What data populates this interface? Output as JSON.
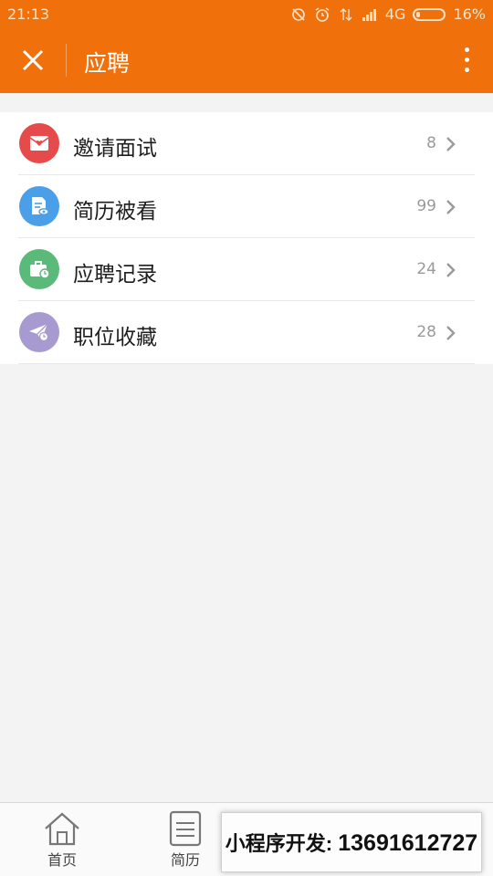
{
  "status_bar": {
    "time": "21:13",
    "network": "4G",
    "battery": "16%"
  },
  "header": {
    "title": "应聘",
    "background_color": "#f0700b"
  },
  "list": {
    "items": [
      {
        "label": "邀请面试",
        "count": "8",
        "icon": "envelope-heart-icon",
        "color": "#e64b4b"
      },
      {
        "label": "简历被看",
        "count": "99",
        "icon": "document-eye-icon",
        "color": "#4a9fe8"
      },
      {
        "label": "应聘记录",
        "count": "24",
        "icon": "briefcase-clock-icon",
        "color": "#5bb97a"
      },
      {
        "label": "职位收藏",
        "count": "28",
        "icon": "paper-plane-clock-icon",
        "color": "#a79ad0"
      }
    ]
  },
  "tabbar": {
    "home": "首页",
    "resume": "简历"
  },
  "ad_banner": {
    "prefix": "小程序开发: ",
    "phone": "13691612727"
  }
}
